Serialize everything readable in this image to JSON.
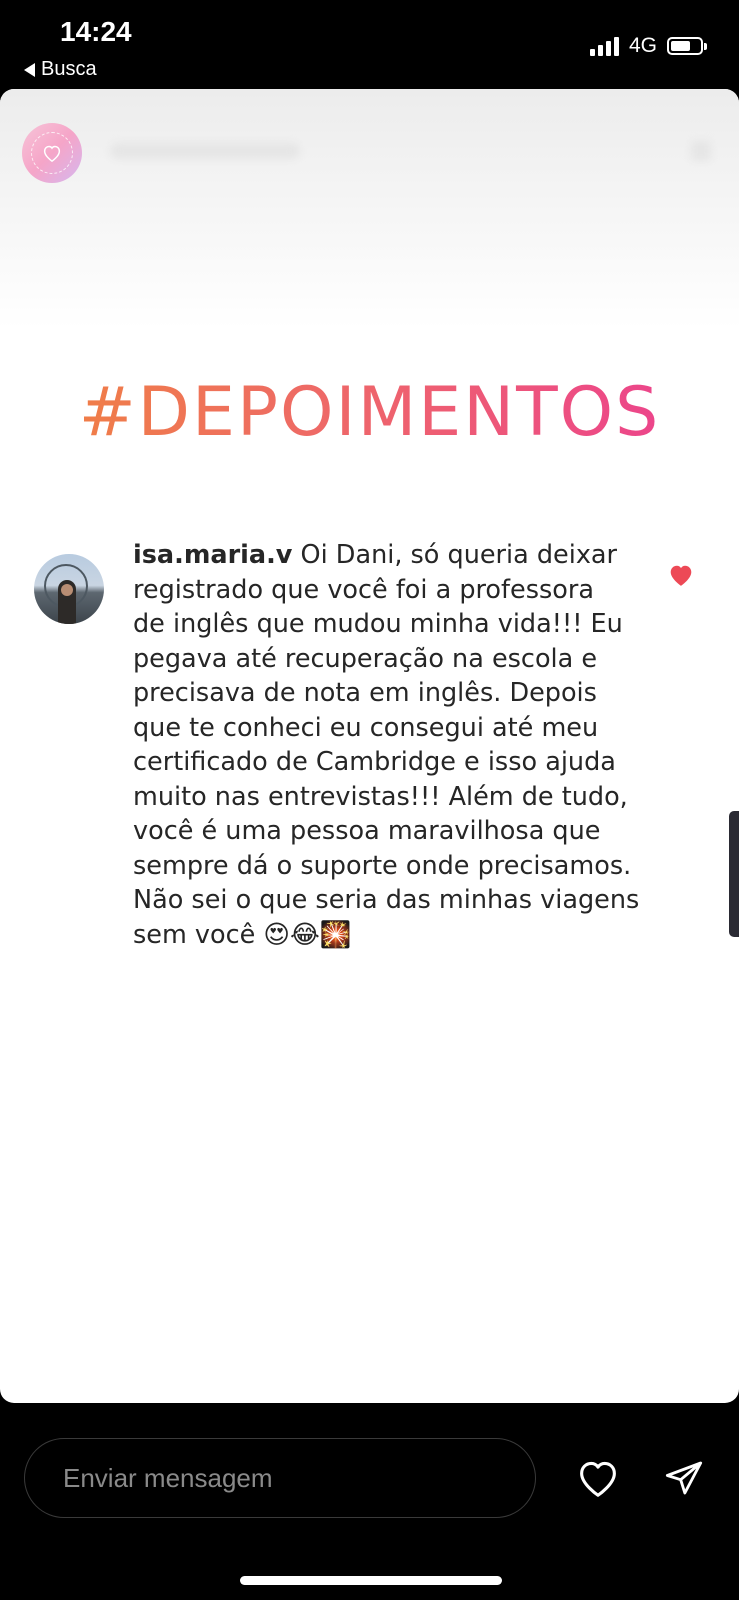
{
  "status_bar": {
    "time": "14:24",
    "back_label": "Busca",
    "network": "4G",
    "signal_bars": 4,
    "battery_level": 0.6
  },
  "story": {
    "hashtag": "#DEPOIMENTOS",
    "hashtag_gradient": [
      "#f0843e",
      "#ee6868",
      "#ec3d93"
    ],
    "comment": {
      "username": "isa.maria.v",
      "text_lines": [
        " Oi Dani, só queria deixar",
        "registrado que você foi a professora",
        "de inglês que mudou minha vida!!! Eu",
        "pegava até recuperação na escola e",
        "precisava de nota em inglês. Depois",
        "que te conheci eu consegui até meu",
        "certificado de Cambridge e isso ajuda",
        "muito nas entrevistas!!! Além de tudo,",
        "você é uma pessoa maravilhosa que",
        "sempre dá o suporte onde precisamos.",
        "Não sei o que seria das minhas viagens",
        "sem você 😍😂🎇"
      ],
      "liked": true,
      "like_color": "#ed4956"
    }
  },
  "bottom_bar": {
    "message_placeholder": "Enviar mensagem",
    "icons": [
      "heart-outline-icon",
      "send-icon"
    ]
  }
}
